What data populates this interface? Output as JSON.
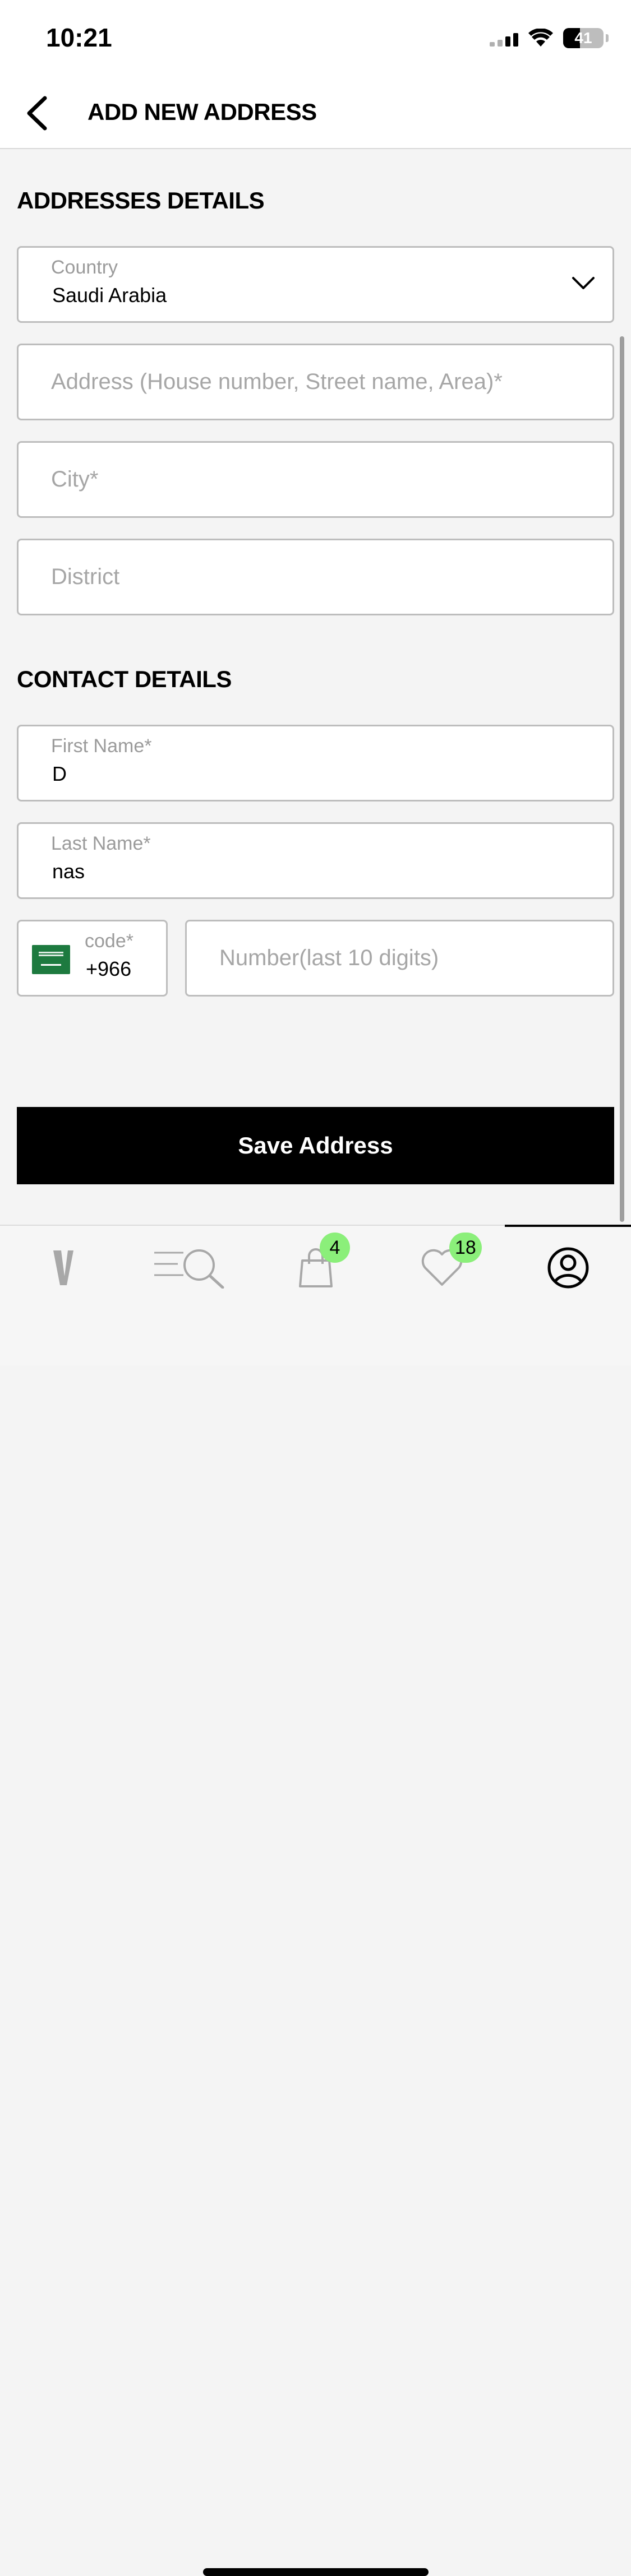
{
  "status": {
    "time": "10:21",
    "battery": "41"
  },
  "header": {
    "title": "ADD NEW ADDRESS"
  },
  "address_section": {
    "title": "ADDRESSES DETAILS"
  },
  "country": {
    "label": "Country",
    "value": "Saudi Arabia"
  },
  "address": {
    "placeholder": "Address (House number, Street name, Area)*"
  },
  "city": {
    "placeholder": "City*"
  },
  "district": {
    "placeholder": "District"
  },
  "contact_section": {
    "title": "CONTACT DETAILS"
  },
  "first_name": {
    "label": "First Name*",
    "value": "D"
  },
  "last_name": {
    "label": "Last Name*",
    "value": "nas"
  },
  "phone_code": {
    "label": "code*",
    "value": "+966"
  },
  "phone_number": {
    "placeholder": "Number(last 10 digits)"
  },
  "save_button": {
    "label": "Save Address"
  },
  "tabbar": {
    "tabs": [
      {
        "name": "home",
        "icon": "v-logo-icon"
      },
      {
        "name": "menu-search",
        "icon": "menu-search-icon"
      },
      {
        "name": "bag",
        "icon": "shopping-bag-icon",
        "badge": "4"
      },
      {
        "name": "wishlist",
        "icon": "heart-icon",
        "badge": "18"
      },
      {
        "name": "account",
        "icon": "user-icon",
        "active": true
      }
    ]
  }
}
